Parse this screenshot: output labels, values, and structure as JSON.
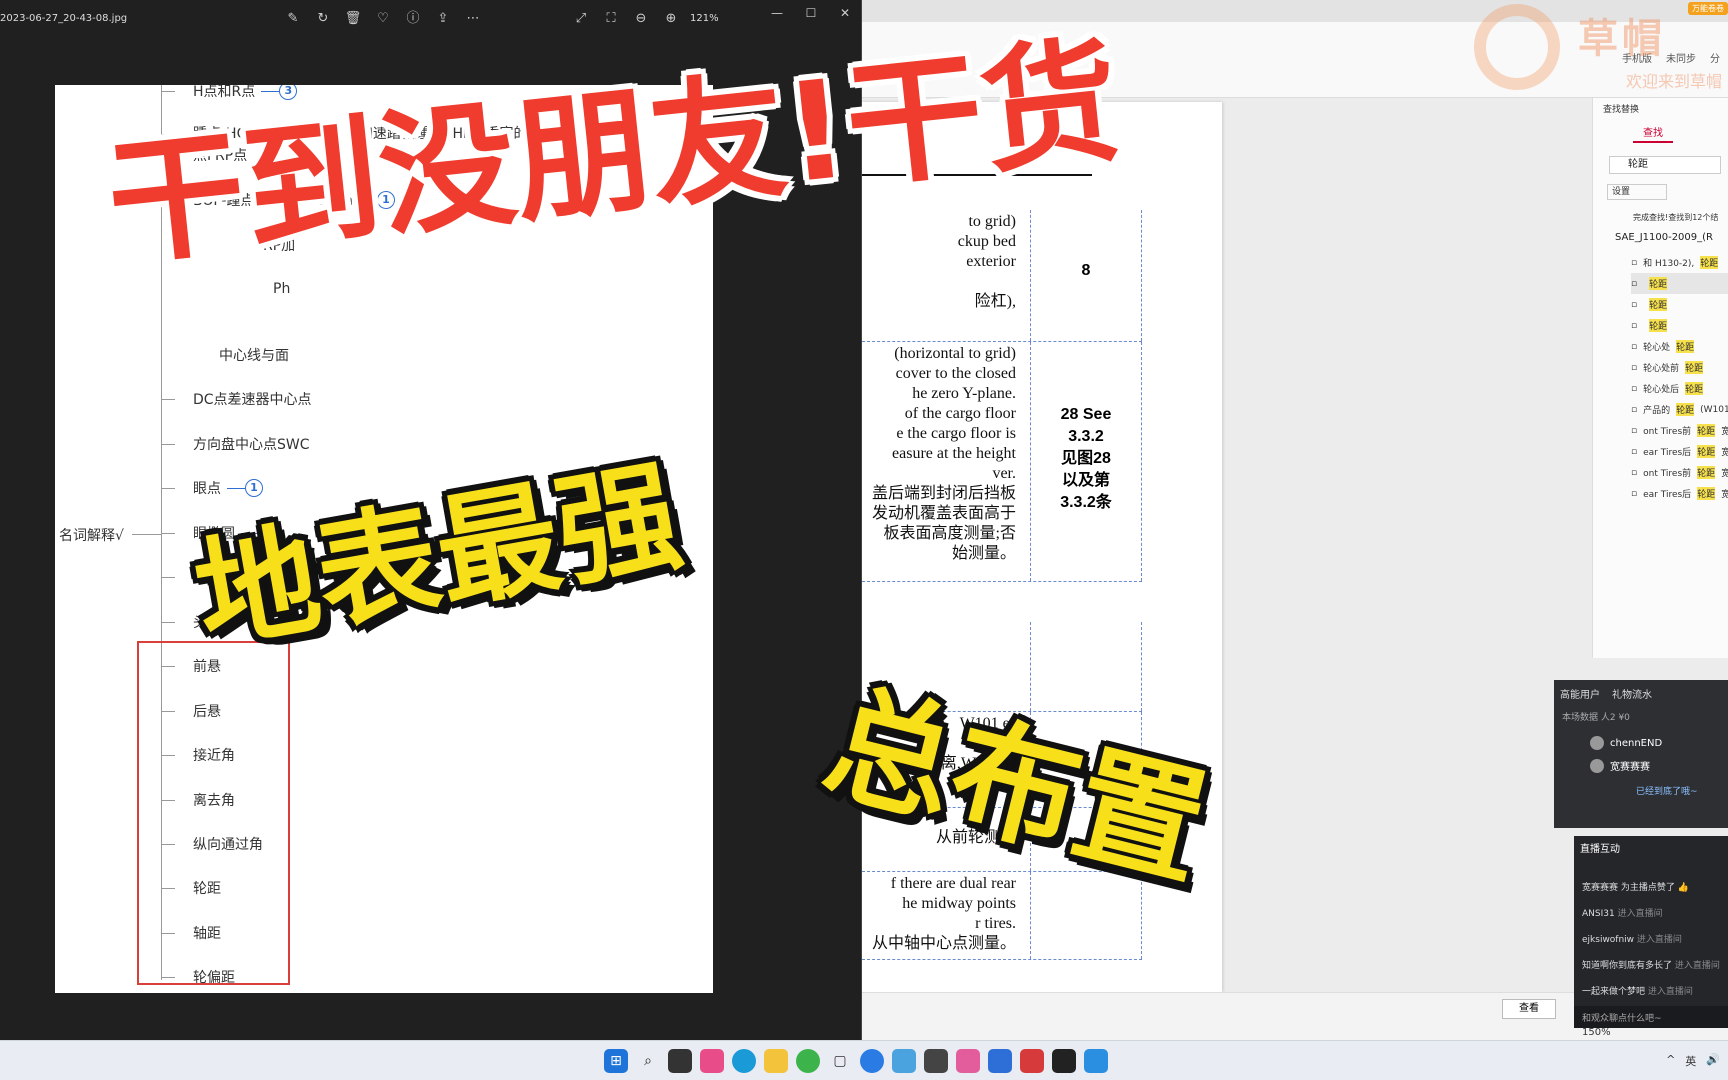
{
  "viewer": {
    "filename": "2023-06-27_20-43-08.jpg",
    "zoom": "121%",
    "toolbar_icons": [
      "edit-icon",
      "rotate-icon",
      "delete-icon",
      "heart-icon",
      "info-icon",
      "share-icon",
      "more-icon"
    ],
    "right_icons": [
      "expand-icon",
      "fit-icon",
      "zoom-out-icon",
      "zoom-in-icon"
    ],
    "window_buttons": {
      "minimize": "—",
      "maximize": "☐",
      "close": "✕"
    }
  },
  "mindmap": {
    "root": "名词解释√",
    "nodes": [
      {
        "text": "H点和R点",
        "badge": "3"
      },
      {
        "text": "踵点-HOS 定义了驾驶员的加速踏板踵点AHP和乘客的地板参考\n点FRP点",
        "badge": ""
      },
      {
        "text": "BOF-踵点HOS点203mm",
        "badge": "1"
      },
      {
        "text": "RP加",
        "badge": ""
      },
      {
        "text": "Ph",
        "badge": ""
      },
      {
        "text": "中心线与面",
        "badge": ""
      },
      {
        "text": "DC点差速器中心点",
        "badge": ""
      },
      {
        "text": "方向盘中心点SWC",
        "badge": ""
      },
      {
        "text": "眼点",
        "badge": "1"
      },
      {
        "text": "眼椭圆",
        "badge": "1"
      },
      {
        "text": "P1/P2点",
        "badge": ""
      },
      {
        "text": "头",
        "badge": ""
      },
      {
        "text": "前悬",
        "badge": ""
      },
      {
        "text": "后悬",
        "badge": ""
      },
      {
        "text": "接近角",
        "badge": ""
      },
      {
        "text": "离去角",
        "badge": ""
      },
      {
        "text": "纵向通过角",
        "badge": ""
      },
      {
        "text": "轮距",
        "badge": ""
      },
      {
        "text": "轴距",
        "badge": ""
      },
      {
        "text": "轮偏距",
        "badge": ""
      }
    ]
  },
  "document": {
    "rows": [
      {
        "text": "to grid)\nckup bed\nexterior\n\n险杠),",
        "num": "8"
      },
      {
        "text": "(horizontal to grid)\ncover to the closed\nhe zero Y-plane.\nof the cargo floor\ne the cargo floor is\neasure at the height\nver.\n盖后端到封闭后挡板\n发动机覆盖表面高于\n板表面高度测量;否\n始测量。",
        "num": "28 See\n3.3.2\n见图28\n以及第\n3.3.2条"
      },
      {
        "text": "",
        "num": ""
      },
      {
        "text": "W101 es\n\n的侧向距离,W101的",
        "num": ""
      },
      {
        "text": "从前轮测量",
        "num": ""
      },
      {
        "text": "f there are dual rear\nhe midway points\nr tires.\n从中轴中心点测量。",
        "num": ""
      }
    ],
    "view_button": "查看",
    "zoom": "150%"
  },
  "editor": {
    "actions": [
      "手机版",
      "未同步",
      "分"
    ]
  },
  "find_panel": {
    "title": "查找替换",
    "tab": "查找",
    "query": "轮距",
    "settings": "设置",
    "summary": "完成查找!查找到12个结",
    "file": "SAE_J1100-2009_(R",
    "results": [
      {
        "pre": "和 H130-2),",
        "hl": "轮距",
        "post": ""
      },
      {
        "pre": "",
        "hl": "轮距",
        "post": ""
      },
      {
        "pre": "",
        "hl": "轮距",
        "post": ""
      },
      {
        "pre": "",
        "hl": "轮距",
        "post": ""
      },
      {
        "pre": "轮心处",
        "hl": "轮距",
        "post": ""
      },
      {
        "pre": "轮心处前",
        "hl": "轮距",
        "post": ""
      },
      {
        "pre": "轮心处后",
        "hl": "轮距",
        "post": ""
      },
      {
        "pre": "产品的",
        "hl": "轮距",
        "post": "(W101"
      },
      {
        "pre": "ont Tires前",
        "hl": "轮距",
        "post": "宽"
      },
      {
        "pre": "ear Tires后",
        "hl": "轮距",
        "post": "宽"
      },
      {
        "pre": "ont Tires前",
        "hl": "轮距",
        "post": "宽度"
      },
      {
        "pre": "ear Tires后",
        "hl": "轮距",
        "post": "宽度"
      }
    ]
  },
  "users_panel": {
    "tabs": [
      "高能用户",
      "礼物流水"
    ],
    "stats": "本场数据 人2 ¥0",
    "users": [
      "chennEND",
      "宽赛赛赛"
    ],
    "end_text": "已经到底了哦~"
  },
  "chat_panel": {
    "title": "直播互动",
    "lines": [
      {
        "user": "宽赛赛赛",
        "msg": "为主播点赞了"
      },
      {
        "user": "ANSI31",
        "msg": "进入直播间"
      },
      {
        "user": "ejksiwofniw",
        "msg": "进入直播间"
      },
      {
        "user": "知道啊你到底有多长了",
        "msg": "进入直播间"
      },
      {
        "user": "一起来做个梦吧",
        "msg": "进入直播间"
      }
    ],
    "input_placeholder": "和观众聊点什么吧~"
  },
  "watermark": {
    "brand": "草帽",
    "welcome": "欢迎来到草帽",
    "badge": "万能卷卷"
  },
  "overlay": {
    "headline": "干到没朋友!干货",
    "line1": "地表最强",
    "line2": "总布置"
  },
  "taskbar": {
    "icons": [
      "windows-start-icon",
      "search-icon",
      "app-icon",
      "app-icon",
      "edge-icon",
      "folder-icon",
      "wechat-icon",
      "files-icon",
      "browser-icon",
      "app-icon",
      "app-icon",
      "app-icon",
      "app-icon",
      "app-icon",
      "app-icon",
      "photos-icon"
    ],
    "tray": [
      "^",
      "英",
      "🔊"
    ]
  }
}
